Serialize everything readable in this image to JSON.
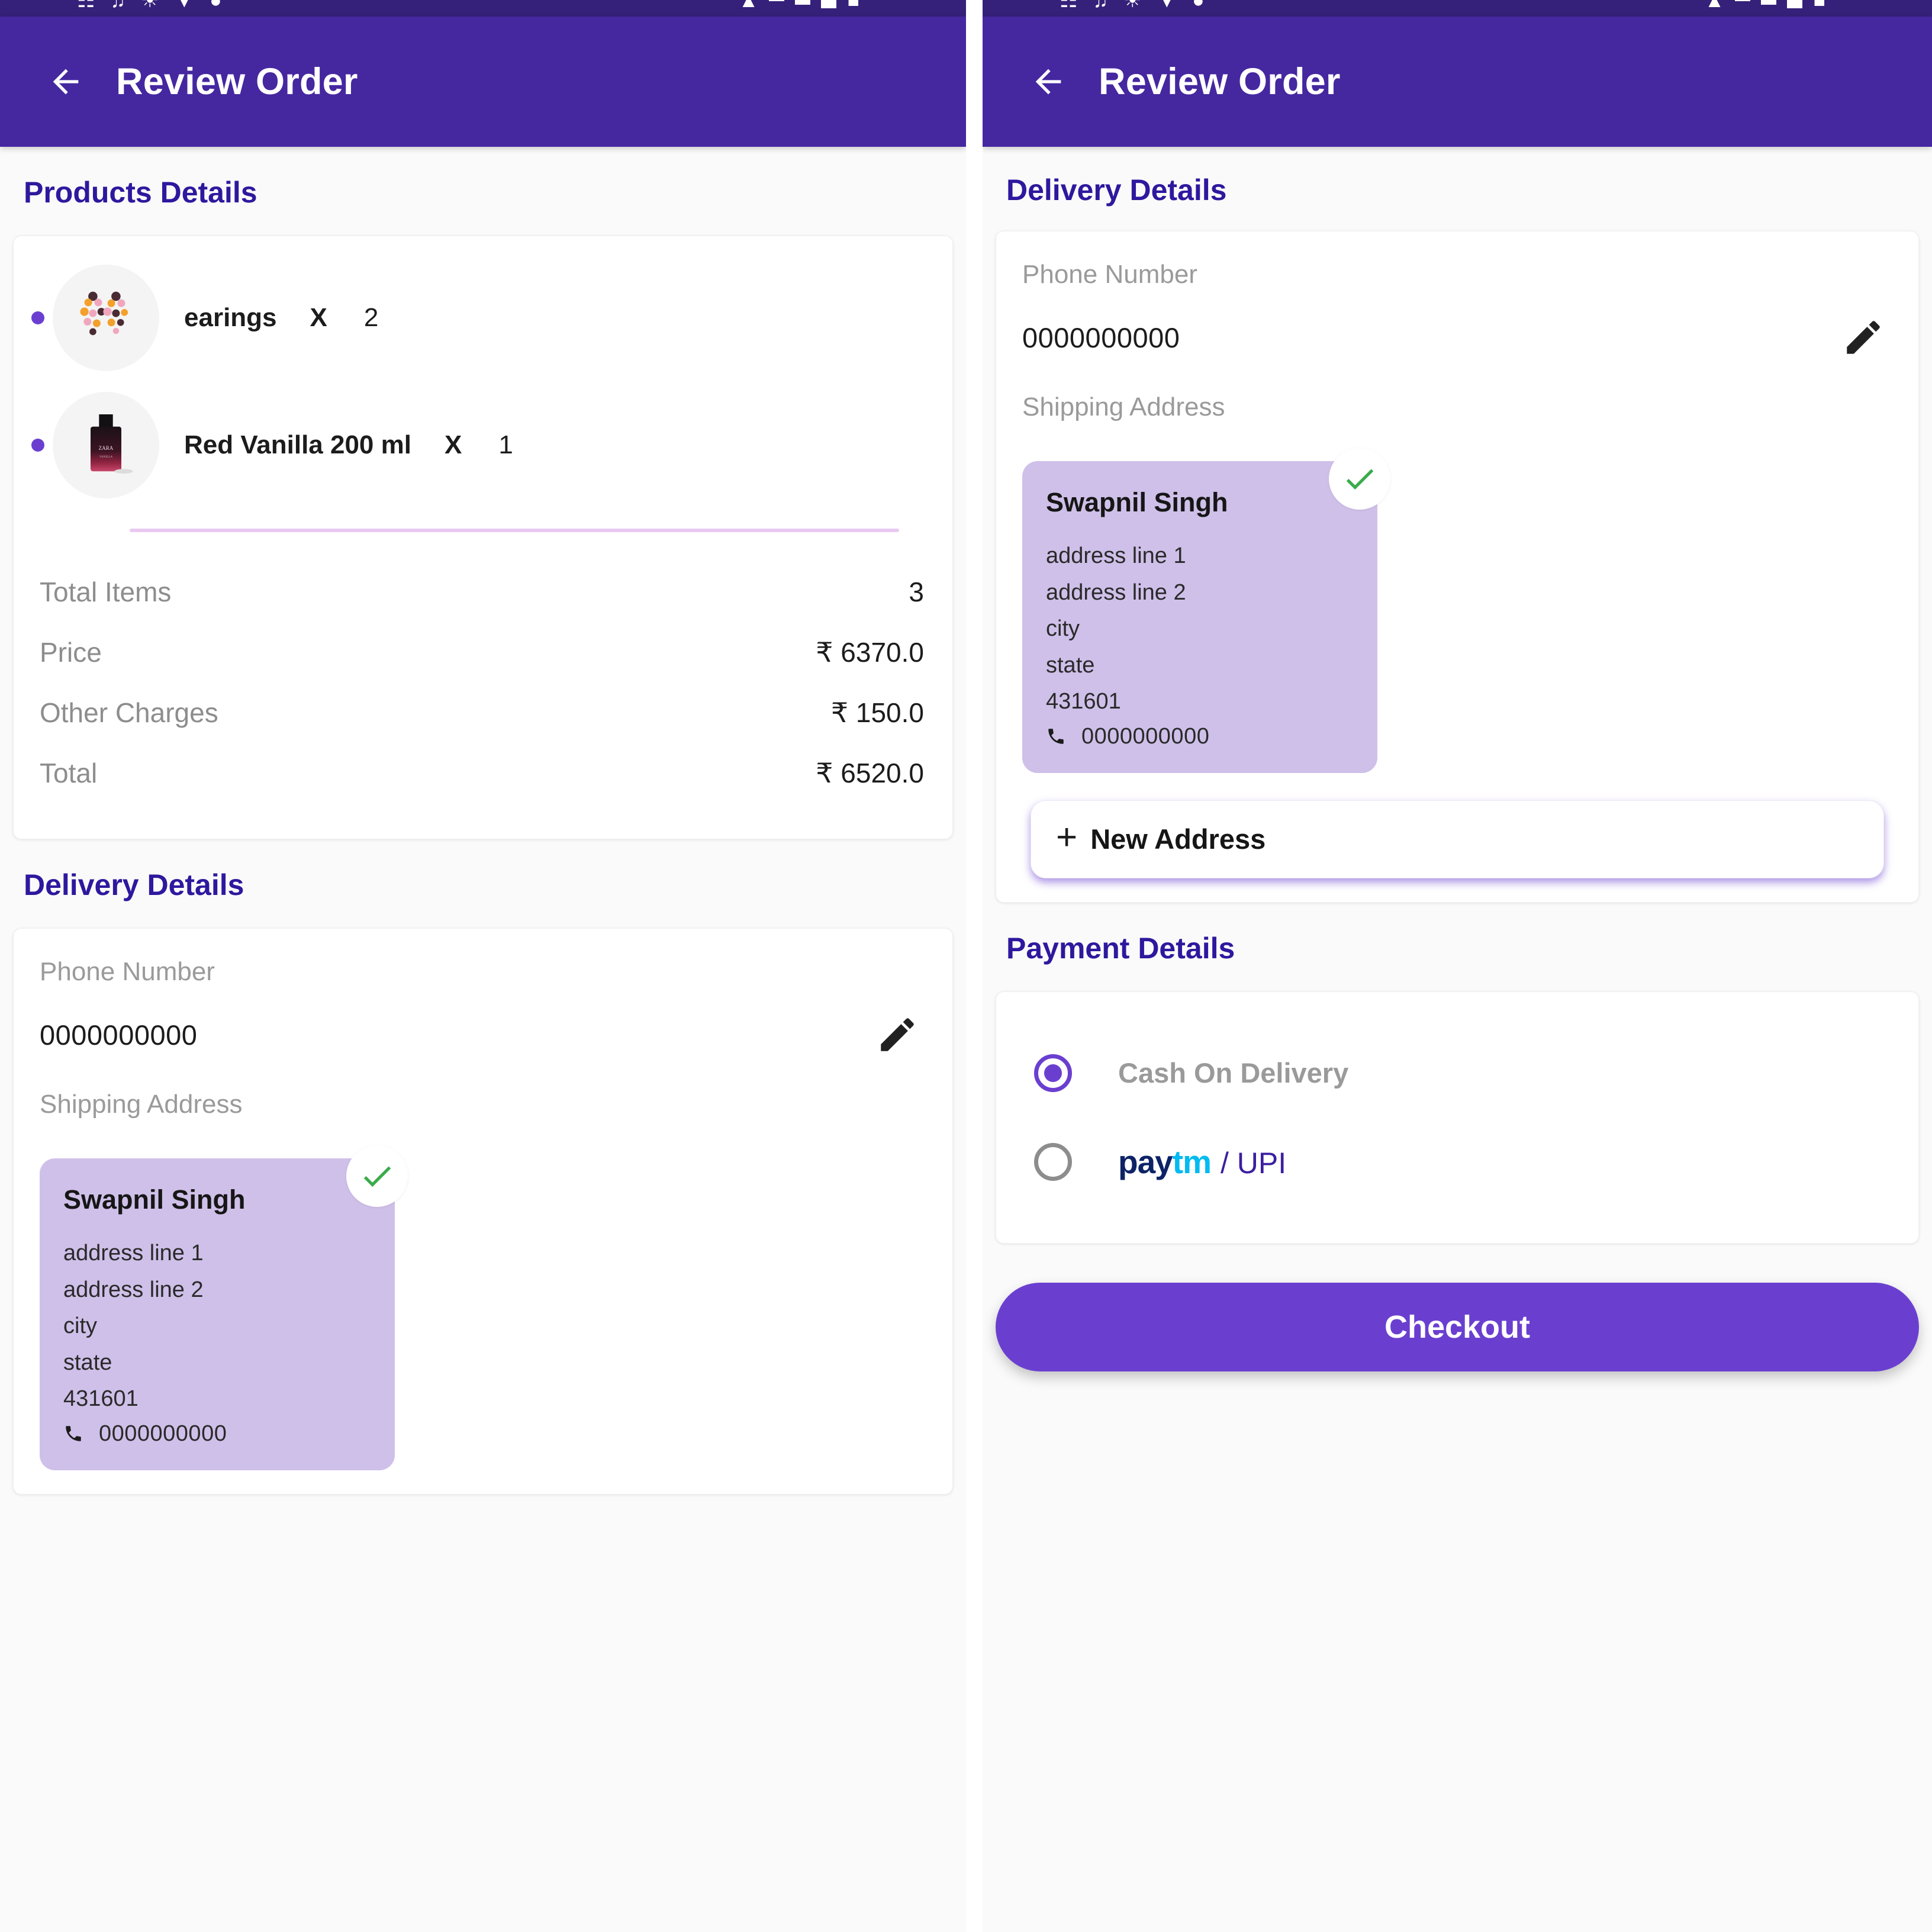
{
  "app": {
    "title": "Review Order",
    "back_icon": "arrow-left-icon",
    "header_color": "#4527a0",
    "accent_color": "#6a3fd0",
    "section_title_color": "#2e189e"
  },
  "left_screen": {
    "products_section": {
      "title": "Products Details",
      "items": [
        {
          "name": "earings",
          "x_label": "X",
          "qty": "2",
          "thumb_icon": "flower-earrings-image"
        },
        {
          "name": "Red Vanilla 200 ml",
          "x_label": "X",
          "qty": "1",
          "thumb_icon": "perfume-bottle-image"
        }
      ],
      "summary": [
        {
          "label": "Total Items",
          "value": "3"
        },
        {
          "label": "Price",
          "value": "₹ 6370.0"
        },
        {
          "label": "Other Charges",
          "value": "₹ 150.0"
        },
        {
          "label": "Total",
          "value": "₹ 6520.0"
        }
      ]
    },
    "delivery_section": {
      "title": "Delivery Details",
      "phone_label": "Phone Number",
      "phone_value": "0000000000",
      "edit_icon": "pencil-icon",
      "shipping_label": "Shipping Address",
      "address": {
        "name": "Swapnil Singh",
        "line1": "address line 1",
        "line2": "address line 2",
        "city": "city",
        "state": "state",
        "pincode": "431601",
        "phone": "0000000000",
        "phone_icon": "phone-icon",
        "selected_icon": "check-icon",
        "card_color": "#cfc0e9"
      }
    }
  },
  "right_screen": {
    "delivery_section": {
      "title": "Delivery Details",
      "phone_label": "Phone Number",
      "phone_value": "0000000000",
      "edit_icon": "pencil-icon",
      "shipping_label": "Shipping Address",
      "address": {
        "name": "Swapnil Singh",
        "line1": "address line 1",
        "line2": "address line 2",
        "city": "city",
        "state": "state",
        "pincode": "431601",
        "phone": "0000000000",
        "phone_icon": "phone-icon",
        "selected_icon": "check-icon",
        "card_color": "#cfc0e9"
      },
      "new_address_label": "New Address",
      "new_address_icon": "plus-icon"
    },
    "payment_section": {
      "title": "Payment Details",
      "options": [
        {
          "label": "Cash On Delivery",
          "selected": true,
          "type": "text"
        },
        {
          "label": "paytm / UPI",
          "paytm_pay": "pay",
          "paytm_tm": "tm",
          "upi": "/ UPI",
          "selected": false,
          "type": "logo"
        }
      ]
    },
    "checkout_label": "Checkout"
  }
}
